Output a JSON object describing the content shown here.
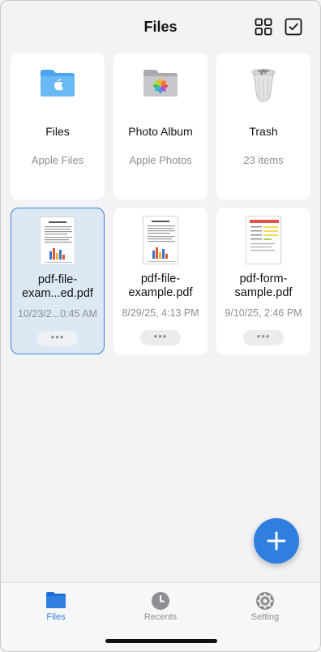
{
  "header": {
    "title": "Files"
  },
  "folders": [
    {
      "name": "Files",
      "subtitle": "Apple Files",
      "icon": "blue-folder-apple-icon"
    },
    {
      "name": "Photo Album",
      "subtitle": "Apple Photos",
      "icon": "gray-folder-photos-icon"
    },
    {
      "name": "Trash",
      "subtitle": "23 items",
      "icon": "trash-can-icon"
    }
  ],
  "files": [
    {
      "name": "pdf-file-exam...ed.pdf",
      "name_line1": "pdf-file-",
      "name_line2": "exam...ed.pdf",
      "date": "10/23/2...0:45 AM",
      "more": "•••",
      "selected": true
    },
    {
      "name": "pdf-file-example.pdf",
      "name_line1": "pdf-file-",
      "name_line2": "example.pdf",
      "date": "8/29/25, 4:13 PM",
      "more": "•••",
      "selected": false
    },
    {
      "name": "pdf-form-sample.pdf",
      "name_line1": "pdf-form-",
      "name_line2": "sample.pdf",
      "date": "9/10/25, 2:46 PM",
      "more": "•••",
      "selected": false
    }
  ],
  "tabbar": [
    {
      "label": "Files",
      "icon": "folder-icon",
      "active": true
    },
    {
      "label": "Recents",
      "icon": "clock-icon",
      "active": false
    },
    {
      "label": "Setting",
      "icon": "gear-icon",
      "active": false
    }
  ],
  "colors": {
    "accent": "#2f7fe0",
    "selected_bg": "#dde8f5",
    "muted": "#8e8e93"
  }
}
